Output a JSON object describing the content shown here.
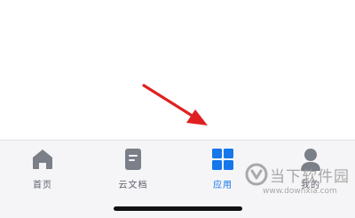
{
  "tabbar": {
    "tabs": [
      {
        "label": "首页",
        "icon": "home-icon"
      },
      {
        "label": "云文档",
        "icon": "document-icon"
      },
      {
        "label": "应用",
        "icon": "apps-grid-icon",
        "active": true
      },
      {
        "label": "我的",
        "icon": "user-icon"
      }
    ],
    "active_color": "#1577ea",
    "inactive_color": "#7a7f88"
  },
  "annotation": {
    "color": "#e02020",
    "icon": "red-arrow-annotation"
  },
  "watermark": {
    "site": "当下软件园",
    "url": "www.downxia.com",
    "logo": "downxia-logo"
  }
}
